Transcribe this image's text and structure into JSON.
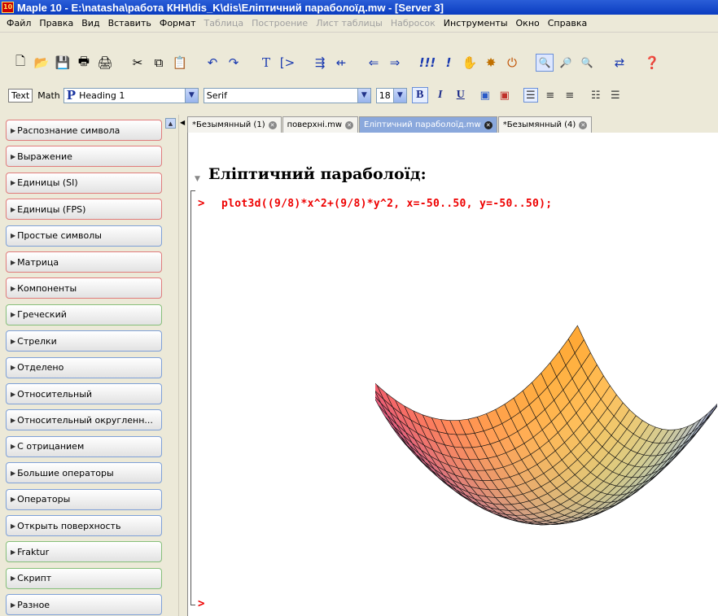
{
  "window": {
    "title": "Maple 10 - E:\\natasha\\работа КНН\\dis_K\\dis\\Еліптичний параболоїд.mw - [Server 3]"
  },
  "menu": [
    {
      "label": "Файл",
      "enabled": true
    },
    {
      "label": "Правка",
      "enabled": true
    },
    {
      "label": "Вид",
      "enabled": true
    },
    {
      "label": "Вставить",
      "enabled": true
    },
    {
      "label": "Формат",
      "enabled": true
    },
    {
      "label": "Таблица",
      "enabled": false
    },
    {
      "label": "Построение",
      "enabled": false
    },
    {
      "label": "Лист таблицы",
      "enabled": false
    },
    {
      "label": "Набросок",
      "enabled": false
    },
    {
      "label": "Инструменты",
      "enabled": true
    },
    {
      "label": "Окно",
      "enabled": true
    },
    {
      "label": "Справка",
      "enabled": true
    }
  ],
  "format_bar": {
    "text_button": "Text",
    "math_label": "Math",
    "paragraph_style": "Heading 1",
    "paragraph_icon": "P",
    "font": "Serif",
    "size": "18",
    "bold": "B",
    "italic": "I",
    "underline": "U"
  },
  "palettes": [
    {
      "label": "Распознание символа",
      "color": "red"
    },
    {
      "label": "Выражение",
      "color": "red"
    },
    {
      "label": "Единицы (SI)",
      "color": "red"
    },
    {
      "label": "Единицы (FPS)",
      "color": "red"
    },
    {
      "label": "Простые символы",
      "color": "blue"
    },
    {
      "label": "Матрица",
      "color": "red"
    },
    {
      "label": "Компоненты",
      "color": "red"
    },
    {
      "label": "Греческий",
      "color": "green"
    },
    {
      "label": "Стрелки",
      "color": "blue"
    },
    {
      "label": "Отделено",
      "color": "blue"
    },
    {
      "label": "Относительный",
      "color": "blue"
    },
    {
      "label": "Относительный округленн...",
      "color": "blue"
    },
    {
      "label": "С отрицанием",
      "color": "blue"
    },
    {
      "label": "Большие операторы",
      "color": "blue"
    },
    {
      "label": "Операторы",
      "color": "blue"
    },
    {
      "label": "Открыть поверхность",
      "color": "blue"
    },
    {
      "label": "Fraktur",
      "color": "green"
    },
    {
      "label": "Скрипт",
      "color": "green"
    },
    {
      "label": "Разное",
      "color": "blue"
    }
  ],
  "tabs": [
    {
      "label": "*Безымянный (1)",
      "active": false
    },
    {
      "label": "поверхні.mw",
      "active": false
    },
    {
      "label": "Еліптичний параболоїд.mw",
      "active": true
    },
    {
      "label": "*Безымянный (4)",
      "active": false
    }
  ],
  "document": {
    "heading": "Еліптичний параболоїд:",
    "prompt": ">",
    "command": "plot3d((9/8)*x^2+(9/8)*y^2, x=-50..50, y=-50..50);",
    "empty_prompt": ">"
  },
  "plot": {
    "type": "surface3d",
    "function": "(9/8)*x^2+(9/8)*y^2",
    "x_range": [
      -50,
      50
    ],
    "y_range": [
      -50,
      50
    ]
  }
}
